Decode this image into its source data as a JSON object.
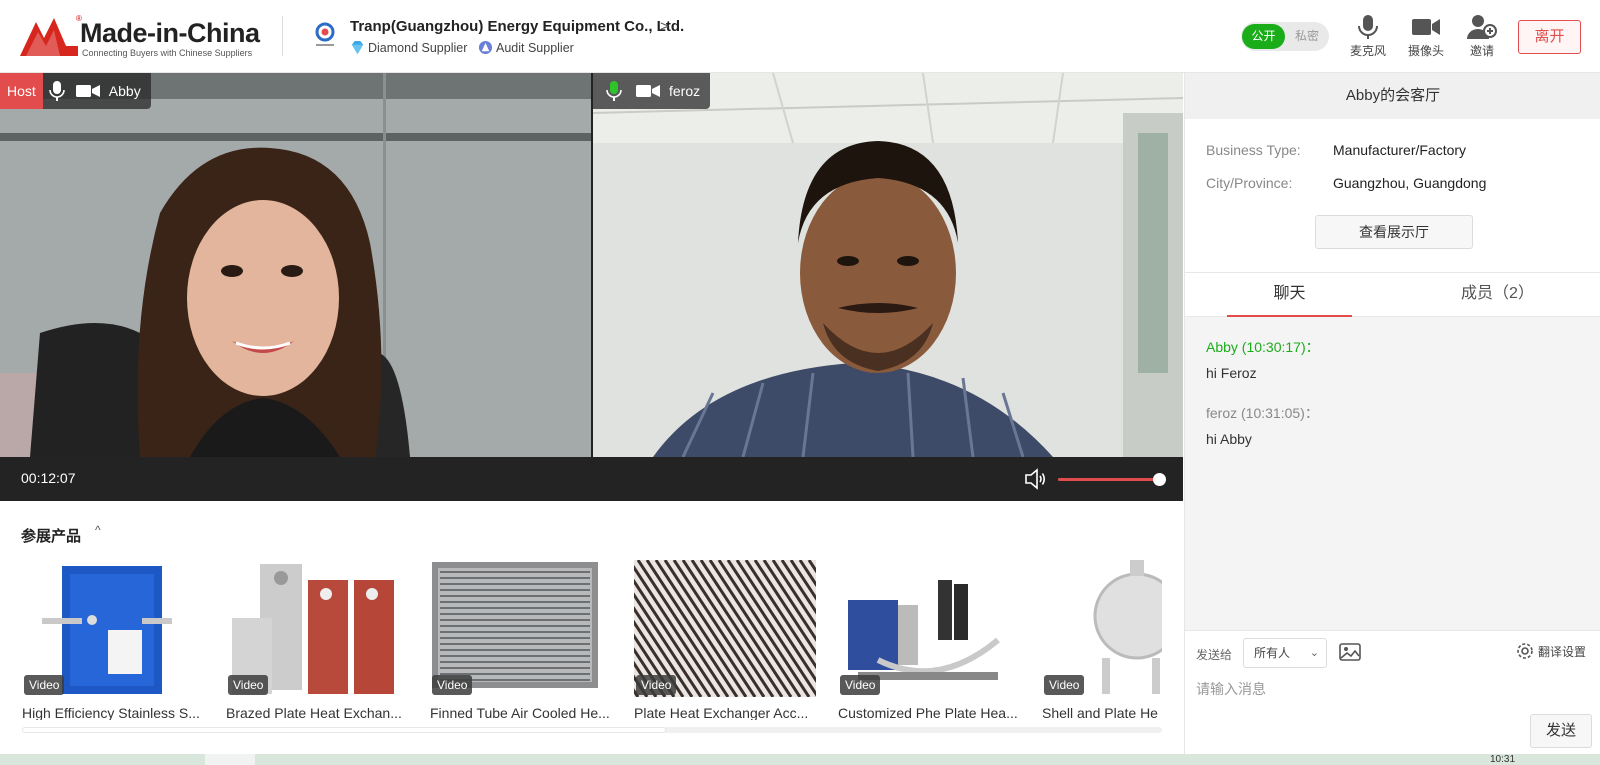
{
  "header": {
    "logo": {
      "text": "Made-in-China",
      "tagline": "Connecting Buyers with Chinese Suppliers",
      "registered": "®"
    },
    "company": {
      "name": "Tranp(Guangzhou) Energy Equipment Co., Ltd.",
      "arrow": ">",
      "badges": [
        {
          "label": "Diamond Supplier",
          "icon": "diamond-icon",
          "color": "#3aa7e8"
        },
        {
          "label": "Audit Supplier",
          "icon": "audit-icon",
          "color": "#6a7fd8"
        }
      ]
    },
    "privacy_toggle": {
      "public_label": "公开",
      "private_label": "私密",
      "selected": "公开"
    },
    "tools": {
      "mic_label": "麦克风",
      "camera_label": "摄像头",
      "invite_label": "邀请"
    },
    "leave_label": "离开"
  },
  "videos": [
    {
      "host_label": "Host",
      "name": "Abby",
      "mic": "mic-icon",
      "camera": "camera-icon"
    },
    {
      "name": "feroz",
      "mic": "mic-icon",
      "camera": "camera-icon"
    }
  ],
  "controls": {
    "elapsed": "00:12:07",
    "volume": 0.95
  },
  "products": {
    "title": "参展产品",
    "caret": "^",
    "items": [
      {
        "tag": "Video",
        "name": "High Efficiency Stainless S..."
      },
      {
        "tag": "Video",
        "name": "Brazed Plate Heat Exchan..."
      },
      {
        "tag": "Video",
        "name": "Finned Tube Air Cooled He..."
      },
      {
        "tag": "Video",
        "name": "Plate Heat Exchanger Acc..."
      },
      {
        "tag": "Video",
        "name": "Customized Phe Plate Hea..."
      },
      {
        "tag": "Video",
        "name": "Shell and Plate He"
      }
    ],
    "scroll_fraction": 0.565
  },
  "side": {
    "room_title": "Abby的会客厅",
    "info": [
      {
        "key": "Business Type:",
        "value": "Manufacturer/Factory"
      },
      {
        "key": "City/Province:",
        "value": "Guangzhou, Guangdong"
      }
    ],
    "showroom_label": "查看展示厅",
    "tabs": {
      "chat": "聊天",
      "members": "成员（2）"
    },
    "messages": [
      {
        "sender": "Abby (10:30:17)：",
        "text": "hi Feroz",
        "self": true
      },
      {
        "sender": "feroz (10:31:05)：",
        "text": "hi Abby",
        "self": false
      }
    ],
    "compose": {
      "send_to_label": "发送给",
      "recipient": "所有人",
      "translate_label": "翻译设置",
      "placeholder": "请输入消息",
      "send_label": "发送"
    }
  },
  "taskbar": {
    "clock": "10:31"
  },
  "colors": {
    "accent_red": "#e24c4c",
    "accent_green": "#1aad19"
  }
}
